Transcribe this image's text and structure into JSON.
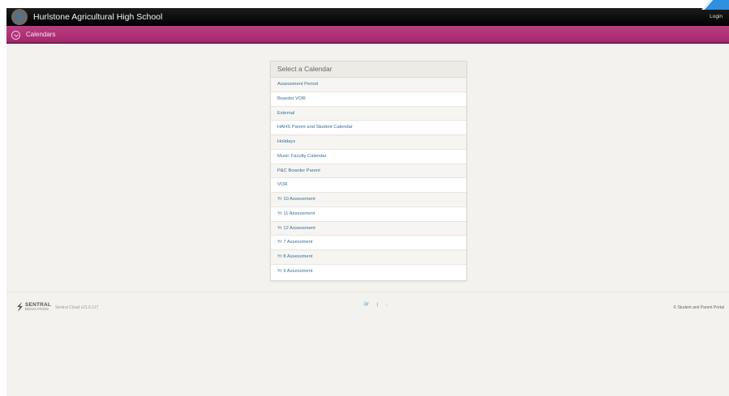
{
  "header": {
    "school_name": "Hurlstone Agricultural High School",
    "login_label": "Login"
  },
  "subheader": {
    "title": "Calendars"
  },
  "calendar_panel": {
    "title": "Select a Calendar",
    "items": [
      "Assessment Period",
      "Boarder VOR",
      "External",
      "HAHS Parent and Student Calendar",
      "Holidays",
      "Music Faculty Calendar",
      "P&C Boarder Parent",
      "VOR",
      "Yr 10 Assessment",
      "Yr 11 Assessment",
      "Yr 12 Assessment",
      "Yr 7 Assessment",
      "Yr 8 Assessment",
      "Yr 9 Assessment"
    ]
  },
  "footer": {
    "brand_name": "SENTRAL",
    "brand_sub": "EDUCATION",
    "version": "Sentral Cloud v21.5.117",
    "social_icons": [
      "twitter-icon",
      "facebook-icon",
      "more-icon"
    ],
    "portal_label": "© Student and Parent Portal"
  },
  "colors": {
    "topbar": "#000000",
    "subbar": "#b1357a",
    "page_background": "#f3f2ee",
    "link": "#3a6d9a",
    "accent_stripe": "#2f8fe0"
  }
}
